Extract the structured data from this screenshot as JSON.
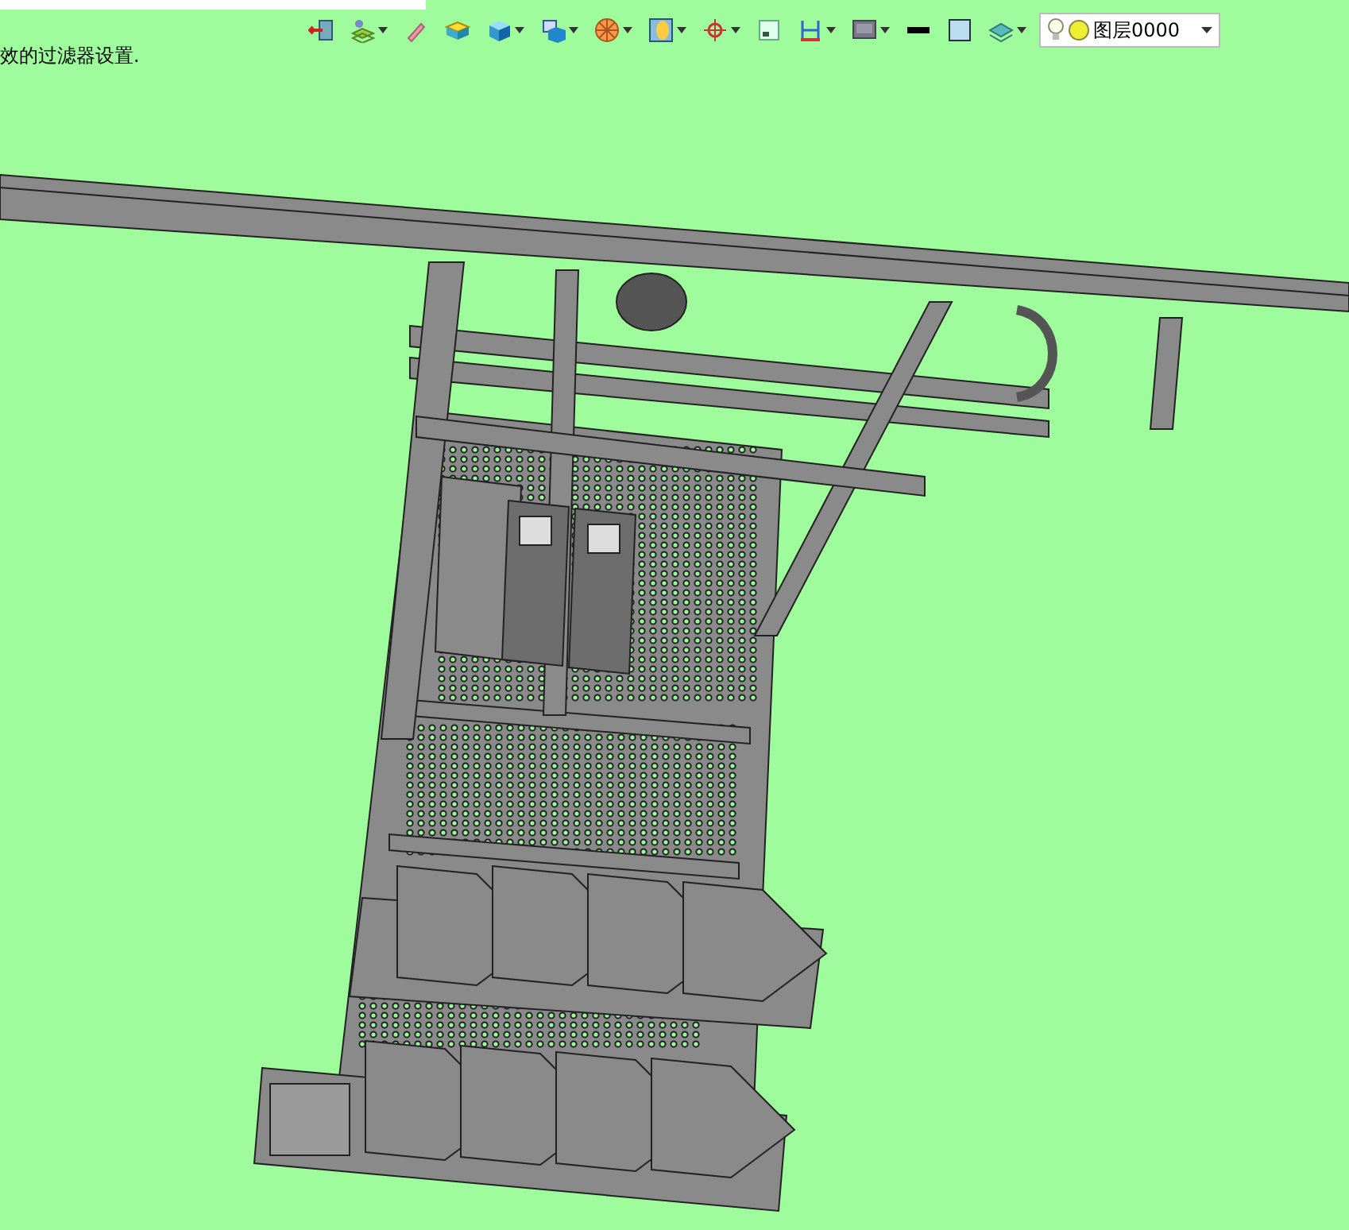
{
  "message": "效的过滤器设置.",
  "toolbar": [
    {
      "has_menu": false
    },
    {
      "has_menu": true
    },
    {
      "has_menu": false
    },
    {
      "has_menu": false
    },
    {
      "has_menu": true
    },
    {
      "has_menu": true
    },
    {
      "has_menu": true
    },
    {
      "has_menu": true
    },
    {
      "has_menu": true
    },
    {
      "has_menu": false
    },
    {
      "has_menu": true
    },
    {
      "has_menu": true
    },
    {
      "has_menu": false
    },
    {
      "has_menu": false
    },
    {
      "has_menu": true
    }
  ],
  "layer_select": {
    "value": "图层0000"
  }
}
